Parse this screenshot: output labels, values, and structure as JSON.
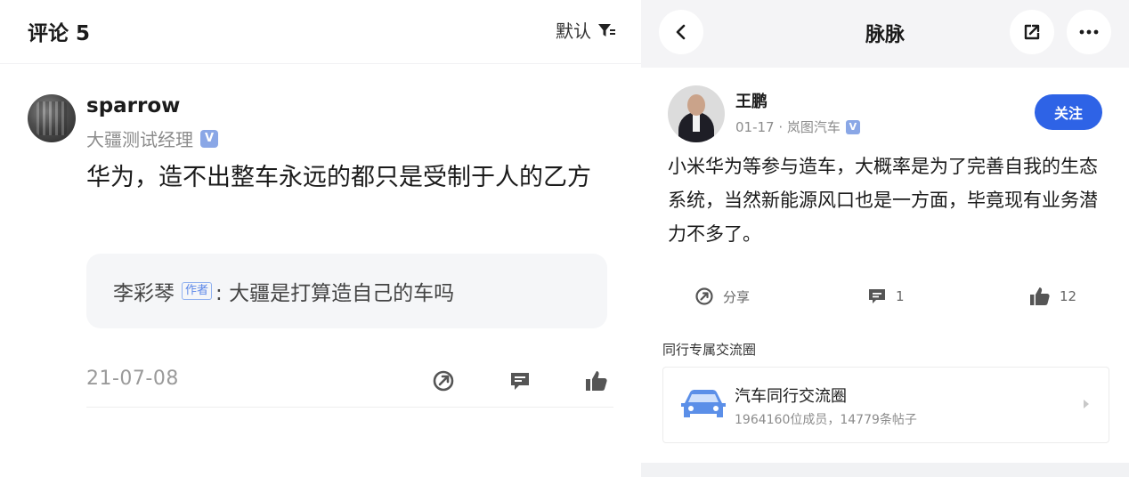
{
  "left": {
    "title": "评论 5",
    "sort_label": "默认",
    "comment": {
      "user": "sparrow",
      "role": "大疆测试经理",
      "badge": "V",
      "text": "华为，造不出整车永远的都只是受制于人的乙方",
      "reply": {
        "name": "李彩琴",
        "author_tag": "作者",
        "text": ": 大疆是打算造自己的车吗"
      },
      "date": "21-07-08"
    },
    "icons": [
      "share-icon",
      "comment-icon",
      "like-icon"
    ]
  },
  "right": {
    "title": "脉脉",
    "post": {
      "user": "王鹏",
      "meta": "01-17 · 岚图汽车",
      "badge": "V",
      "follow_label": "关注",
      "text": "小米华为等参与造车，大概率是为了完善自我的生态系统，当然新能源风口也是一方面，毕竟现有业务潜力不多了。",
      "share_label": "分享",
      "comment_count": "1",
      "like_count": "12"
    },
    "circle": {
      "section_title": "同行专属交流圈",
      "name": "汽车同行交流圈",
      "stats": "1964160位成员，14779条帖子"
    },
    "icons": [
      "back-icon",
      "external-link-icon",
      "more-icon",
      "car-icon"
    ]
  },
  "colors": {
    "accent": "#2e63e6",
    "badge": "#8aa7e6",
    "muted_text": "#8c8c8c",
    "reply_bg": "#f5f6f8"
  }
}
